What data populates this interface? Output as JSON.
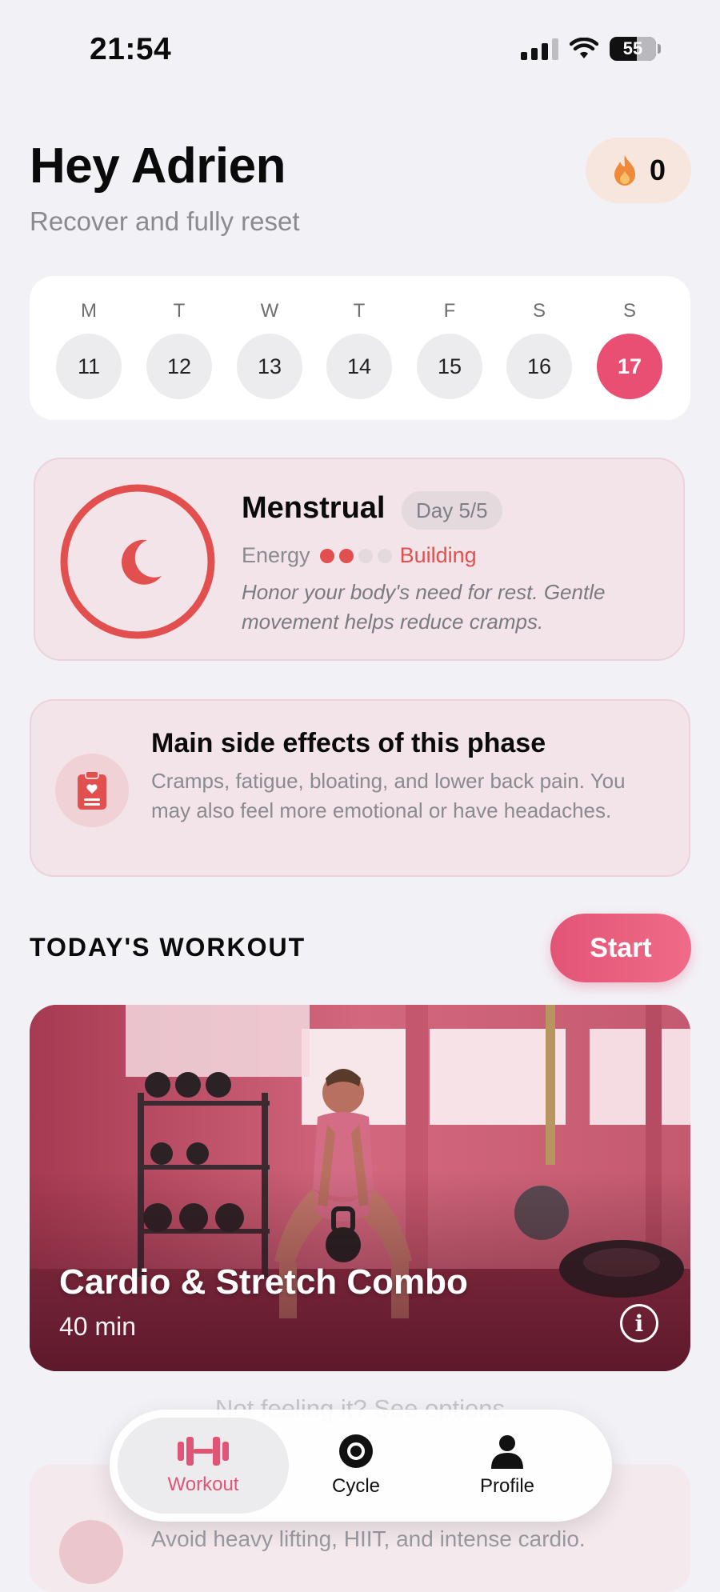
{
  "status_bar": {
    "time": "21:54",
    "battery": "55"
  },
  "header": {
    "greeting": "Hey Adrien",
    "subtitle": "Recover and fully reset",
    "streak_count": "0"
  },
  "week": [
    {
      "letter": "M",
      "date": "11",
      "active": false
    },
    {
      "letter": "T",
      "date": "12",
      "active": false
    },
    {
      "letter": "W",
      "date": "13",
      "active": false
    },
    {
      "letter": "T",
      "date": "14",
      "active": false
    },
    {
      "letter": "F",
      "date": "15",
      "active": false
    },
    {
      "letter": "S",
      "date": "16",
      "active": false
    },
    {
      "letter": "S",
      "date": "17",
      "active": true
    }
  ],
  "phase": {
    "name": "Menstrual",
    "day_chip": "Day 5/5",
    "energy_label": "Energy",
    "energy_level": 2,
    "energy_max": 4,
    "energy_status": "Building",
    "description": "Honor your body's need for rest. Gentle movement helps reduce cramps.",
    "accent_color": "#e24f4f"
  },
  "side_effects": {
    "title": "Main side effects of this phase",
    "description": "Cramps, fatigue, bloating, and lower back pain. You may also feel more emotional or have headaches."
  },
  "workout": {
    "section_title": "TODAY'S WORKOUT",
    "start_label": "Start",
    "title": "Cardio & Stretch Combo",
    "duration": "40 min"
  },
  "below_nav": {
    "options_link": "Not feeling it? See options",
    "caution": "Avoid heavy lifting, HIIT, and intense cardio."
  },
  "tabbar": {
    "tabs": [
      {
        "label": "Workout",
        "active": true
      },
      {
        "label": "Cycle",
        "active": false
      },
      {
        "label": "Profile",
        "active": false
      }
    ]
  },
  "colors": {
    "brand": "#e84f73",
    "background": "#f2f1f6"
  }
}
